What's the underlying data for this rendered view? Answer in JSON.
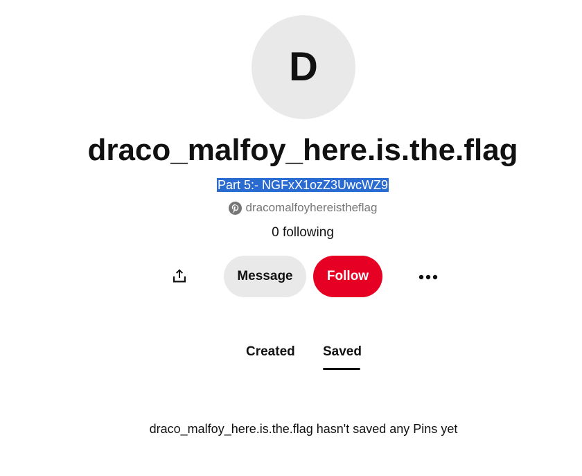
{
  "profile": {
    "avatar_initial": "D",
    "display_name": "draco_malfoy_here.is.the.flag",
    "about": "Part 5:- NGFxX1ozZ3UwcWZ9",
    "username": "dracomalfoyhereistheflag",
    "following": "0 following"
  },
  "actions": {
    "share_icon": "share-icon",
    "message_label": "Message",
    "follow_label": "Follow",
    "more_icon": "more-options-icon"
  },
  "tabs": [
    {
      "label": "Created",
      "active": false
    },
    {
      "label": "Saved",
      "active": true
    }
  ],
  "content": {
    "empty_message": "draco_malfoy_here.is.the.flag hasn't saved any Pins yet"
  },
  "colors": {
    "follow_button": "#e60023",
    "message_button": "#e9e9e9",
    "avatar_background": "#e9e9e9",
    "selection_highlight": "#2a6bd1"
  }
}
